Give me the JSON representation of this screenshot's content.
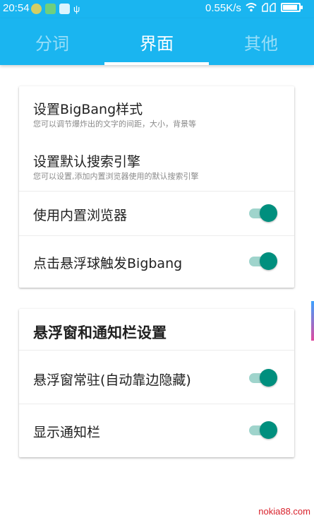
{
  "status_bar": {
    "time": "20:54",
    "network_speed": "0.55K/s",
    "battery_level": 0.9,
    "icons": [
      "notification-app-icon",
      "notification-app-icon",
      "screenshot-icon",
      "usb-icon",
      "wifi-icon",
      "signal-icon",
      "battery-icon"
    ]
  },
  "tabs": [
    {
      "label": "分词",
      "selected": false
    },
    {
      "label": "界面",
      "selected": true
    },
    {
      "label": "其他",
      "selected": false
    }
  ],
  "settings_card": {
    "bigbang_style": {
      "title": "设置BigBang样式",
      "subtitle": "您可以调节爆炸出的文字的间距，大小，背景等"
    },
    "default_search": {
      "title": "设置默认搜索引擎",
      "subtitle": "您可以设置,添加内置浏览器使用的默认搜索引擎"
    },
    "builtin_browser": {
      "title": "使用内置浏览器",
      "enabled": true
    },
    "float_trigger": {
      "title": "点击悬浮球触发Bigbang",
      "enabled": true
    }
  },
  "float_card": {
    "header": "悬浮窗和通知栏设置",
    "float_resident": {
      "title": "悬浮窗常驻(自动靠边隐藏)",
      "enabled": true
    },
    "show_notification": {
      "title": "显示通知栏",
      "enabled": true
    }
  },
  "colors": {
    "primary": "#1ab5f0",
    "switch_on_thumb": "#008f7e",
    "switch_on_track": "#9fd4cc"
  },
  "watermark": "nokia88.com"
}
